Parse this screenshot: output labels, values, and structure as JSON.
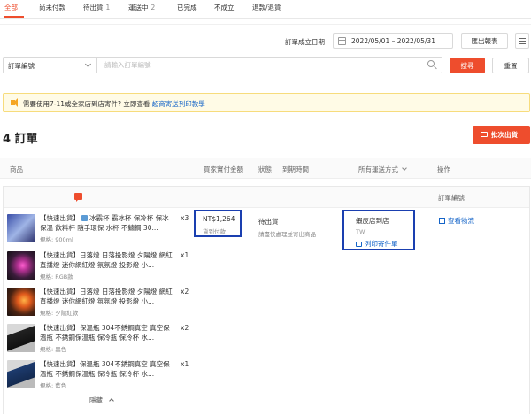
{
  "tabs": [
    {
      "label": "全部",
      "count": ""
    },
    {
      "label": "尚未付款",
      "count": ""
    },
    {
      "label": "待出貨",
      "count": "1"
    },
    {
      "label": "運送中",
      "count": "2"
    },
    {
      "label": "已完成",
      "count": ""
    },
    {
      "label": "不成立",
      "count": ""
    },
    {
      "label": "退款/退貨",
      "count": ""
    }
  ],
  "filters": {
    "date_label": "訂單成立日期",
    "date_range": "2022/05/01 – 2022/05/31",
    "export_label": "匯出報表",
    "search_field": "訂單編號",
    "search_placeholder": "請輸入訂單編號",
    "search_button": "搜尋",
    "reset_button": "重置"
  },
  "notice": {
    "text": "需要使用7-11或全家店到店寄件? 立即查看",
    "link": "超商寄送列印教學"
  },
  "orders": {
    "title": "4 訂單",
    "batch_button": "批次出貨"
  },
  "table_headers": {
    "product": "商品",
    "amount": "買家實付金額",
    "status": "狀態",
    "deadline": "到期時間",
    "shipping": "所有運送方式",
    "action": "操作"
  },
  "order": {
    "order_no_label": "訂單編號",
    "items": [
      {
        "name_prefix": "【快速出貨】",
        "name": "冰霸杯 霸冰杯 保冷杯 保冰保溫 飲料杯 隨手環保 水杯 不鏽鋼 30...",
        "spec": "規格: 900ml",
        "qty": "x3"
      },
      {
        "name_prefix": "",
        "name": "【快速出貨】日落燈 日落投影燈 夕陽燈 網紅直播燈 迷你網紅燈 氛氛燈 投影燈 小...",
        "spec": "規格: RGB款",
        "qty": "x1"
      },
      {
        "name_prefix": "",
        "name": "【快速出貨】日落燈 日落投影燈 夕陽燈 網紅直播燈 迷你網紅燈 氛氛燈 投影燈 小...",
        "spec": "規格: 夕陽紅款",
        "qty": "x2"
      },
      {
        "name_prefix": "",
        "name": "【快速出貨】保溫瓶 304不銹鋼真空 真空保溫瓶 不銹鋼保溫瓶 保冷瓶 保冷杯 水...",
        "spec": "規格: 黑色",
        "qty": "x2"
      },
      {
        "name_prefix": "",
        "name": "【快速出貨】保溫瓶 304不銹鋼真空 真空保溫瓶 不銹鋼保溫瓶 保冷瓶 保冷杯 水...",
        "spec": "規格: 藍色",
        "qty": "x1"
      }
    ],
    "amount": "NT$1,264",
    "payment": "貨到付款",
    "status": "待出貨",
    "status_note": "請盡快處理並寄出商品",
    "carrier": "蝦皮店到店",
    "region": "TW",
    "print_label": "列印寄件單",
    "track_label": "查看物流",
    "collapse_label": "隱藏"
  },
  "colors": {
    "accent": "#ee4d2d",
    "link": "#1464c8",
    "highlight_border": "#1a3fb0"
  }
}
